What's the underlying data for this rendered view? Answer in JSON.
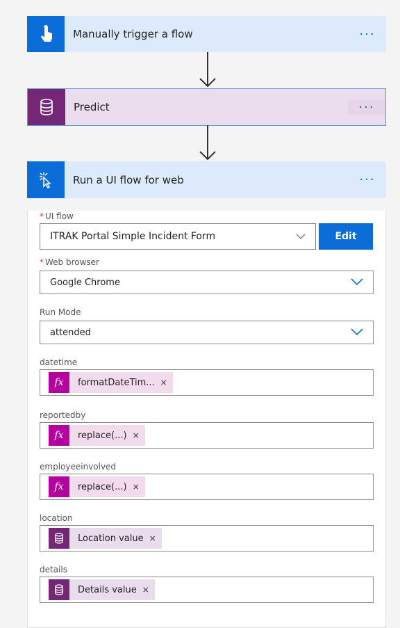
{
  "steps": {
    "trigger": {
      "title": "Manually trigger a flow",
      "more": "···"
    },
    "predict": {
      "title": "Predict",
      "more": "···"
    },
    "uiflow": {
      "title": "Run a UI flow for web",
      "more": "···"
    }
  },
  "form": {
    "ui_flow": {
      "label": "UI flow",
      "required": "*",
      "value": "ITRAK Portal Simple Incident Form",
      "edit_label": "Edit"
    },
    "web_browser": {
      "label": "Web browser",
      "required": "*",
      "value": "Google Chrome"
    },
    "run_mode": {
      "label": "Run Mode",
      "value": "attended"
    },
    "datetime": {
      "label": "datetime",
      "chip": "formatDateTim...",
      "remove": "×"
    },
    "reportedby": {
      "label": "reportedby",
      "chip": "replace(...)",
      "remove": "×"
    },
    "employeeinvolved": {
      "label": "employeeinvolved",
      "chip": "replace(...)",
      "remove": "×"
    },
    "location": {
      "label": "location",
      "chip": "Location value",
      "remove": "×"
    },
    "details": {
      "label": "details",
      "chip": "Details value",
      "remove": "×"
    }
  },
  "colors": {
    "trigger_icon_bg": "#0b6ed8",
    "trigger_header_bg": "#dceafb",
    "predict_icon_bg": "#742774",
    "predict_header_bg": "#ebdded",
    "uiflow_icon_bg": "#0b6ed8",
    "uiflow_header_bg": "#dceafb",
    "edit_button": "#0b6ed8",
    "fx_icon": "#b4009e",
    "db_icon": "#742774"
  },
  "icons": {
    "trigger": "touch-hand-icon",
    "predict": "database-icon",
    "uiflow": "cursor-click-icon"
  }
}
